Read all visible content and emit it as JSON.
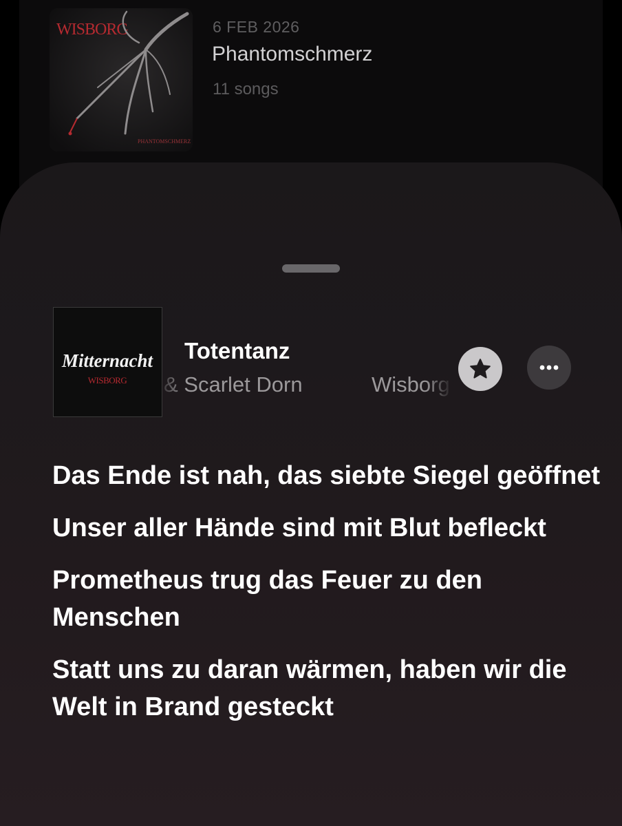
{
  "release": {
    "date": "6 FEB 2026",
    "title": "Phantomschmerz",
    "song_count": "11 songs",
    "artwork": {
      "logo": "WISBORG",
      "caption": "PHANTOMSCHMERZ"
    }
  },
  "now_playing": {
    "title": "Totentanz",
    "artist_segment_1": "& Scarlet Dorn",
    "artist_segment_2": "Wisborg",
    "artwork": {
      "title": "Mitternacht",
      "logo": "WISBORG"
    },
    "favorite_icon": "star-icon",
    "more_icon": "ellipsis-icon"
  },
  "lyrics": [
    "Das Ende ist nah, das siebte Siegel geöffnet",
    "Unser aller Hände sind mit Blut befleckt",
    "Prometheus trug das Feuer zu den Menschen",
    "Statt uns zu daran wärmen, haben wir die Welt in Brand gesteckt"
  ],
  "colors": {
    "accent_red": "#c0262d",
    "sheet_background": "#1d191c",
    "lyric_text": "#ffffff",
    "secondary_text": "#9c999b"
  }
}
